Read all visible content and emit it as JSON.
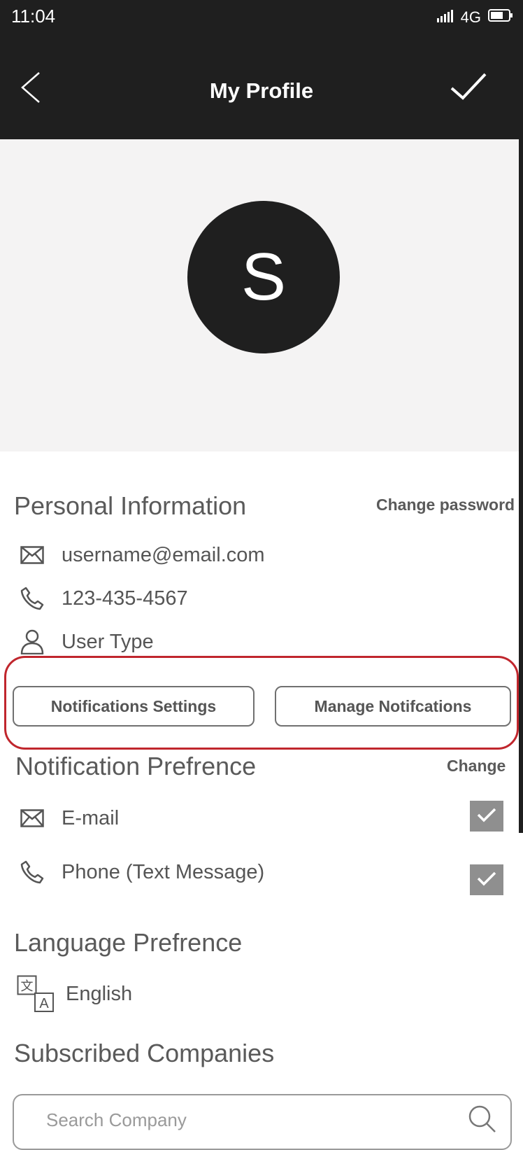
{
  "status_bar": {
    "time": "11:04",
    "network": "4G",
    "signal_icon": "signal-bars-icon",
    "battery_icon": "battery-icon"
  },
  "header": {
    "title": "My Profile",
    "back_icon": "chevron-left-icon",
    "confirm_icon": "check-icon"
  },
  "avatar": {
    "initial": "S"
  },
  "personal_info": {
    "title": "Personal Information",
    "change_password": "Change password",
    "email": "username@email.com",
    "phone": "123-435-4567",
    "user_type": "User Type"
  },
  "notification_actions": {
    "settings_label": "Notifications Settings",
    "manage_label": "Manage Notifcations",
    "highlight_color": "#c0262d"
  },
  "notification_pref": {
    "title": "Notification Prefrence",
    "change_label": "Change",
    "options": [
      {
        "label": "E-mail",
        "checked": true
      },
      {
        "label": "Phone (Text Message)",
        "checked": true
      }
    ]
  },
  "language_pref": {
    "title": "Language  Prefrence",
    "value": "English",
    "icon": "translate-icon"
  },
  "subscribed": {
    "title": "Subscribed Companies",
    "search_placeholder": "Search Company"
  },
  "colors": {
    "dark": "#1f1f1f",
    "light_bg": "#f4f3f3",
    "checkbox": "#8f8f8f"
  }
}
